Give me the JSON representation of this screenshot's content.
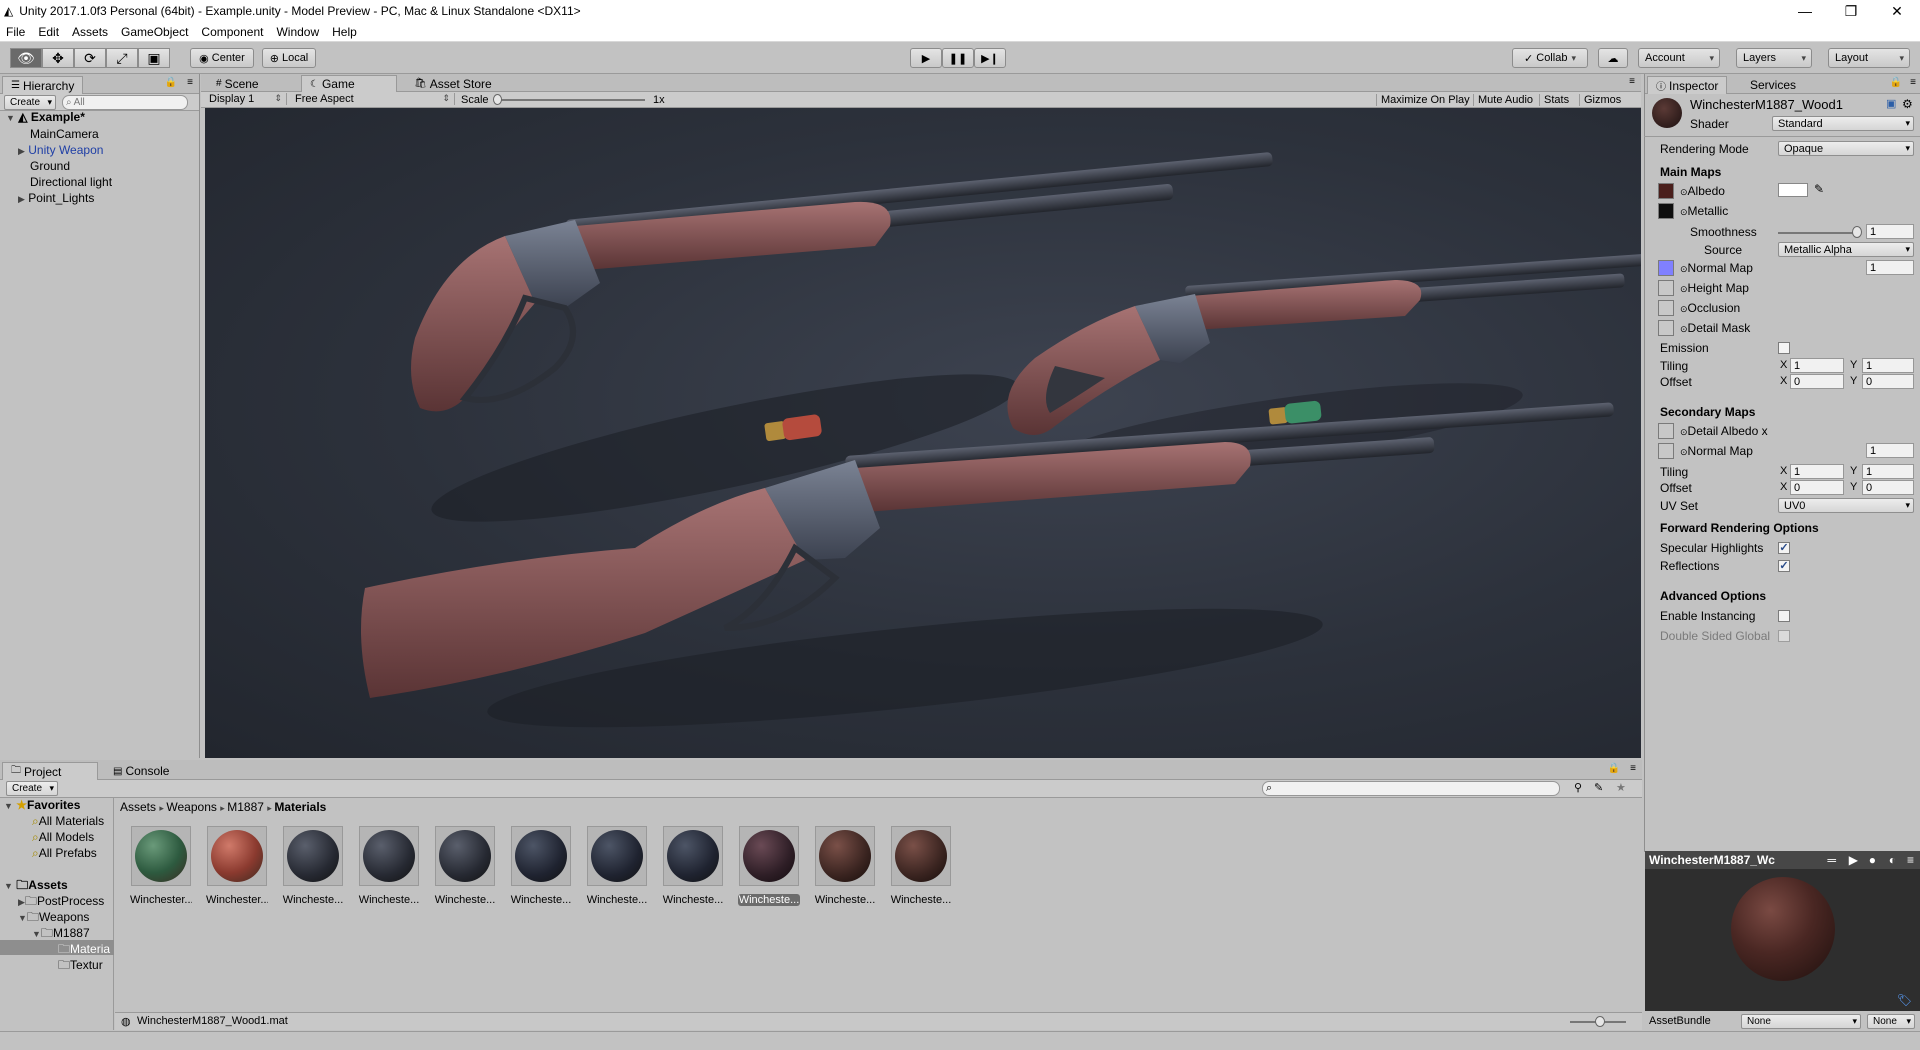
{
  "window": {
    "title": "Unity 2017.1.0f3 Personal (64bit) - Example.unity - Model Preview - PC, Mac & Linux Standalone <DX11>"
  },
  "menu": [
    "File",
    "Edit",
    "Assets",
    "GameObject",
    "Component",
    "Window",
    "Help"
  ],
  "toolbar": {
    "center": "Center",
    "local": "Local",
    "collab": "Collab",
    "account": "Account",
    "layers": "Layers",
    "layout": "Layout"
  },
  "hierarchy": {
    "tab": "Hierarchy",
    "create": "Create",
    "search_placeholder": "All",
    "scene": "Example*",
    "items": [
      "MainCamera",
      "Unity Weapon",
      "Ground",
      "Directional light",
      "Point_Lights"
    ]
  },
  "scene_tabs": [
    "Scene",
    "Game",
    "Asset Store"
  ],
  "game_bar": {
    "display": "Display 1",
    "aspect": "Free Aspect",
    "scale_label": "Scale",
    "scale_value": "1x",
    "maximize": "Maximize On Play",
    "mute": "Mute Audio",
    "stats": "Stats",
    "gizmos": "Gizmos"
  },
  "inspector": {
    "tab": "Inspector",
    "services_tab": "Services",
    "material_name": "WinchesterM1887_Wood1",
    "shader_label": "Shader",
    "shader_value": "Standard",
    "rendering_mode_label": "Rendering Mode",
    "rendering_mode_value": "Opaque",
    "main_maps": "Main Maps",
    "albedo": "Albedo",
    "metallic": "Metallic",
    "smoothness": "Smoothness",
    "smoothness_value": "1",
    "smoothness_level": 1.0,
    "source": "Source",
    "source_value": "Metallic Alpha",
    "normal_map": "Normal Map",
    "normal_value": "1",
    "height_map": "Height Map",
    "occlusion": "Occlusion",
    "detail_mask": "Detail Mask",
    "emission": "Emission",
    "tiling": "Tiling",
    "offset": "Offset",
    "x": "X",
    "y": "Y",
    "tiling_x": "1",
    "tiling_y": "1",
    "offset_x": "0",
    "offset_y": "0",
    "secondary_maps": "Secondary Maps",
    "detail_albedo": "Detail Albedo x",
    "normal_map2": "Normal Map",
    "normal2_value": "1",
    "tiling2_x": "1",
    "tiling2_y": "1",
    "offset2_x": "0",
    "offset2_y": "0",
    "uv_set": "UV Set",
    "uv_set_value": "UV0",
    "forward": "Forward Rendering Options",
    "specular": "Specular Highlights",
    "reflections": "Reflections",
    "advanced": "Advanced Options",
    "instancing": "Enable Instancing",
    "double_sided": "Double Sided Global",
    "preview_title": "WinchesterM1887_Wc",
    "assetbundle": "AssetBundle",
    "ab_none": "None",
    "ab_none2": "None"
  },
  "project": {
    "tab": "Project",
    "console_tab": "Console",
    "create": "Create",
    "favorites": "Favorites",
    "fav_items": [
      "All Materials",
      "All Models",
      "All Prefabs"
    ],
    "assets": "Assets",
    "tree": [
      "PostProcess",
      "Weapons",
      "M1887",
      "Materia",
      "Textur"
    ],
    "breadcrumb": [
      "Assets",
      "Weapons",
      "M1887",
      "Materials"
    ],
    "materials": [
      "Winchester...",
      "Winchester...",
      "Wincheste...",
      "Wincheste...",
      "Wincheste...",
      "Wincheste...",
      "Wincheste...",
      "Wincheste...",
      "Wincheste...",
      "Wincheste...",
      "Wincheste..."
    ],
    "selected_index": 8,
    "status_file": "WinchesterM1887_Wood1.mat"
  }
}
